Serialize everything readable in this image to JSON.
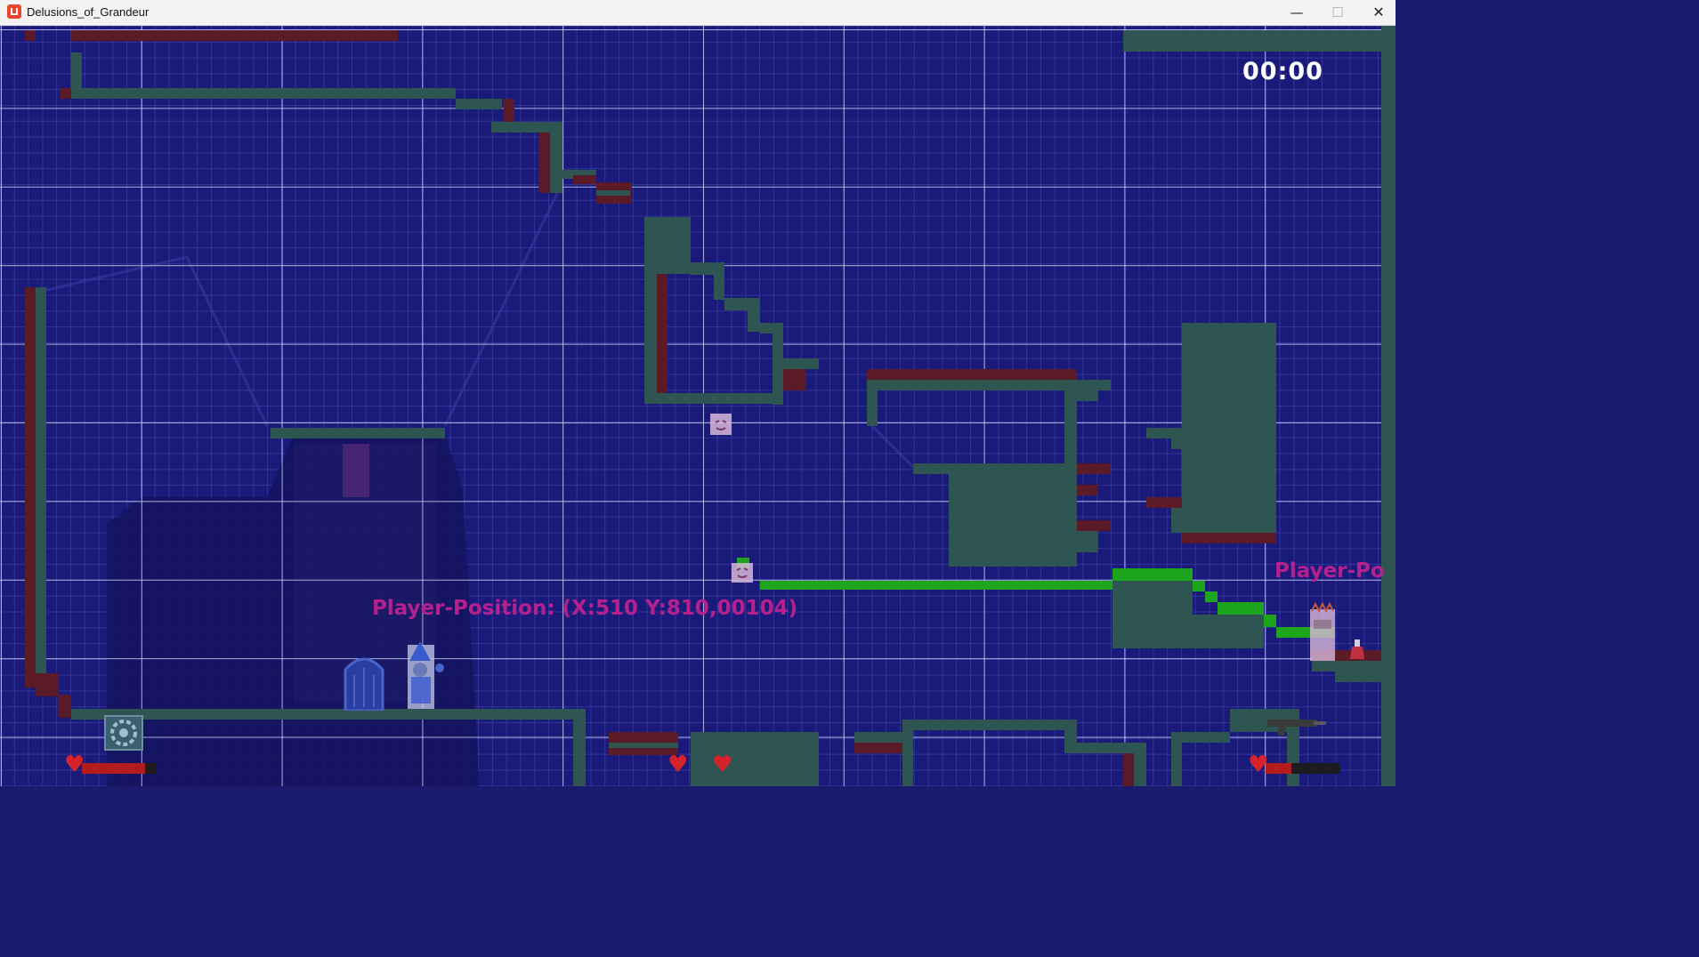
{
  "window": {
    "title": "Delusions_of_Grandeur",
    "minimize_glyph": "—",
    "maximize_glyph": "☐",
    "close_glyph": "✕"
  },
  "hud": {
    "timer": "00:00",
    "player1_position": "Player-Position: (X:510 Y:810,00104)",
    "player2_position_partial": "Player-Po",
    "player1_health": 0.85,
    "player2_health": 0.35
  },
  "icons": {
    "heart": "♥",
    "app": "monogame-icon",
    "gear": "gear-icon",
    "gun": "gun-icon",
    "potion": "potion-icon"
  },
  "colors": {
    "background": "#1a1a7a",
    "platform": "#2f5552",
    "brick": "#5a1a26",
    "laser": "#1ea51e",
    "position_text": "#b5208f",
    "heart": "#d6232b"
  }
}
